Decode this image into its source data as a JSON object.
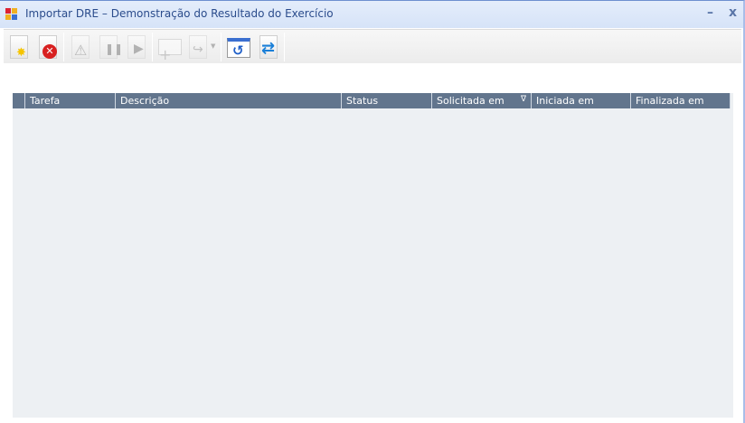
{
  "window": {
    "title": "Importar DRE – Demonstração do Resultado do Exercício",
    "minimize": "–",
    "close": "x"
  },
  "toolbar": {
    "buttons": [
      {
        "name": "new-icon",
        "enabled": true
      },
      {
        "name": "cancel-icon",
        "enabled": true
      },
      {
        "name": "warning-icon",
        "enabled": false
      },
      {
        "name": "pause-icon",
        "enabled": false
      },
      {
        "name": "play-icon",
        "enabled": false
      },
      {
        "name": "add-row-icon",
        "enabled": false
      },
      {
        "name": "redirect-icon",
        "enabled": false
      },
      {
        "name": "undo-icon",
        "enabled": true
      },
      {
        "name": "refresh-icon",
        "enabled": true
      }
    ]
  },
  "grid": {
    "columns": [
      "Tarefa",
      "Descrição",
      "Status",
      "Solicitada em",
      "Iniciada em",
      "Finalizada em"
    ],
    "sort_indicator": "∇",
    "rows": []
  }
}
